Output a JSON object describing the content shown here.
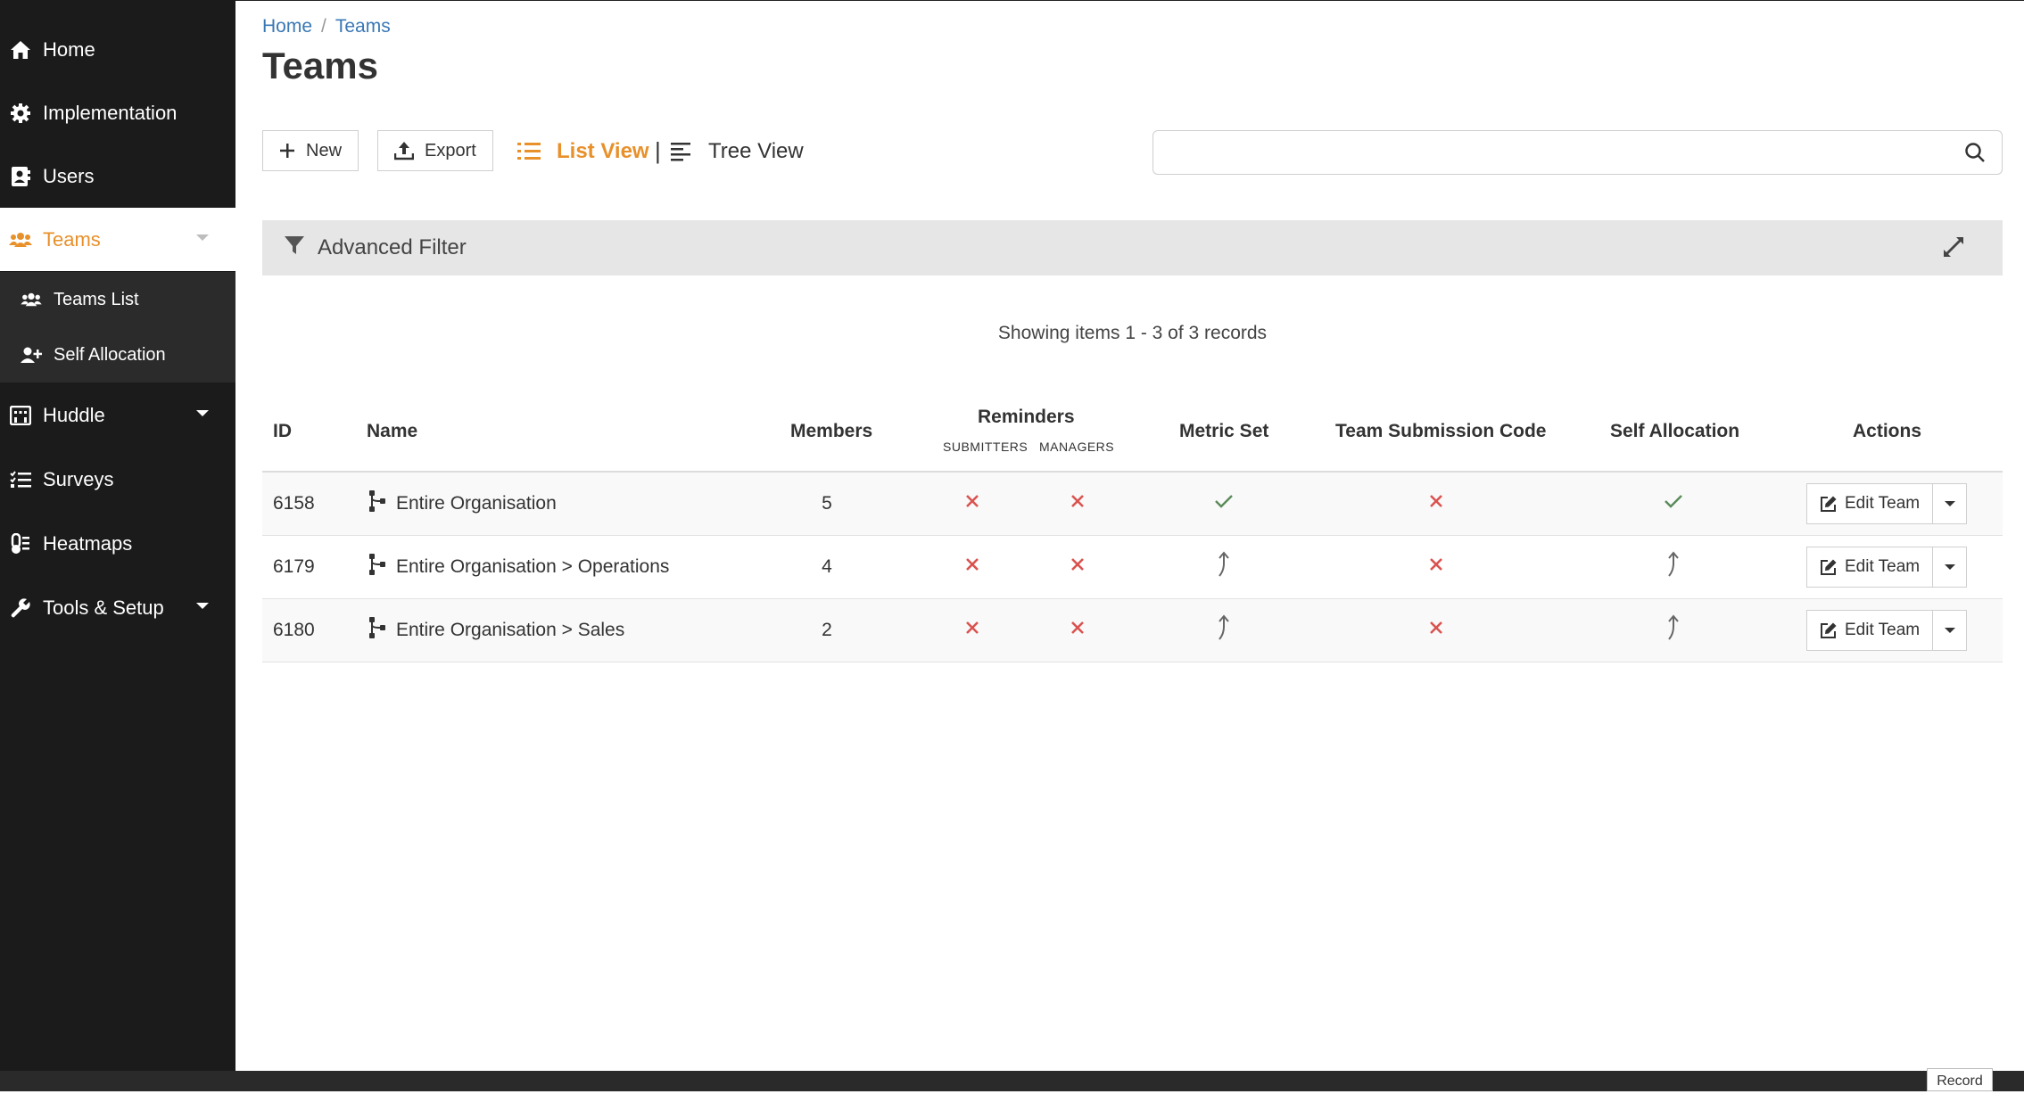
{
  "sidebar": {
    "items": [
      {
        "label": "Home",
        "icon": "home-icon"
      },
      {
        "label": "Implementation",
        "icon": "gear-icon"
      },
      {
        "label": "Users",
        "icon": "address-card-icon"
      },
      {
        "label": "Teams",
        "icon": "users-icon",
        "active": true
      },
      {
        "label": "Huddle",
        "icon": "huddle-icon"
      },
      {
        "label": "Surveys",
        "icon": "list-check-icon"
      },
      {
        "label": "Heatmaps",
        "icon": "thermometer-icon"
      },
      {
        "label": "Tools & Setup",
        "icon": "wrench-icon"
      }
    ],
    "sub_items": [
      {
        "label": "Teams List",
        "icon": "users-icon"
      },
      {
        "label": "Self Allocation",
        "icon": "user-plus-icon"
      }
    ]
  },
  "breadcrumb": {
    "home": "Home",
    "separator": "/",
    "current": "Teams"
  },
  "page_title": "Teams",
  "toolbar": {
    "new_label": "New",
    "export_label": "Export",
    "list_view_label": "List View",
    "separator": "|",
    "tree_view_label": "Tree View"
  },
  "search": {
    "value": "",
    "placeholder": ""
  },
  "advanced_filter": {
    "label": "Advanced Filter"
  },
  "records_text": "Showing items 1 - 3 of 3 records",
  "table": {
    "headers": {
      "id": "ID",
      "name": "Name",
      "members": "Members",
      "reminders": "Reminders",
      "reminders_submitters": "SUBMITTERS",
      "reminders_managers": "MANAGERS",
      "metric_set": "Metric Set",
      "team_submission_code": "Team Submission Code",
      "self_allocation": "Self Allocation",
      "actions": "Actions"
    },
    "rows": [
      {
        "id": "6158",
        "name": "Entire Organisation",
        "members": "5",
        "submitters": "no",
        "managers": "no",
        "metric_set": "yes",
        "submission_code": "no",
        "self_allocation": "yes",
        "action_label": "Edit Team"
      },
      {
        "id": "6179",
        "name": "Entire Organisation > Operations",
        "members": "4",
        "submitters": "no",
        "managers": "no",
        "metric_set": "inherited",
        "submission_code": "no",
        "self_allocation": "inherited",
        "action_label": "Edit Team"
      },
      {
        "id": "6180",
        "name": "Entire Organisation > Sales",
        "members": "2",
        "submitters": "no",
        "managers": "no",
        "metric_set": "inherited",
        "submission_code": "no",
        "self_allocation": "inherited",
        "action_label": "Edit Team"
      }
    ]
  },
  "record_tab_label": "Record",
  "colors": {
    "accent": "#e8902a",
    "no": "#d9534f",
    "yes": "#5a8a5a",
    "sidebar": "#1b1b1b",
    "link": "#3a78b5"
  }
}
